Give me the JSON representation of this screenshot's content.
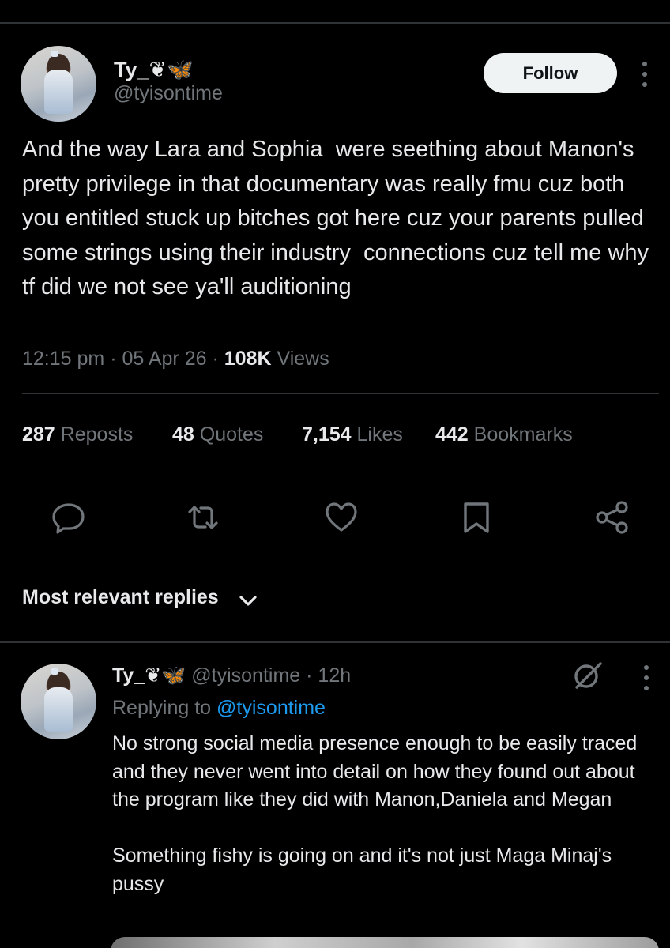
{
  "tweet": {
    "display_name": "Ty_❦🦋",
    "handle": "@tyisontime",
    "follow_label": "Follow",
    "text": "And the way Lara and Sophia  were seething about Manon's pretty privilege in that documentary was really fmu cuz both you entitled stuck up bitches got here cuz your parents pulled some strings using their industry  connections cuz tell me why tf did we not see ya'll auditioning",
    "time": "12:15 pm",
    "date": "05 Apr 26",
    "views_count": "108K",
    "views_label": "Views"
  },
  "stats": {
    "reposts": {
      "count": "287",
      "label": "Reposts"
    },
    "quotes": {
      "count": "48",
      "label": "Quotes"
    },
    "likes": {
      "count": "7,154",
      "label": "Likes"
    },
    "bookmarks": {
      "count": "442",
      "label": "Bookmarks"
    }
  },
  "actions": [
    "reply-icon",
    "repost-icon",
    "like-icon",
    "bookmark-icon",
    "share-icon"
  ],
  "replies_sort": {
    "label": "Most relevant replies"
  },
  "reply": {
    "display_name": "Ty_❦🦋",
    "handle": "@tyisontime",
    "age": "12h",
    "replying_prefix": "Replying to",
    "replying_handle": "@tyisontime",
    "text": "No strong social media presence enough to be easily traced and they never went into detail on how they found out about the program like they did with Manon,Daniela and Megan\n\nSomething fishy is going on and it's not just Maga Minaj's pussy"
  },
  "colors": {
    "background": "#000000",
    "text_primary": "#e7e9ea",
    "text_secondary": "#71767b",
    "link": "#1d9bf0",
    "divider": "#2f3336"
  }
}
